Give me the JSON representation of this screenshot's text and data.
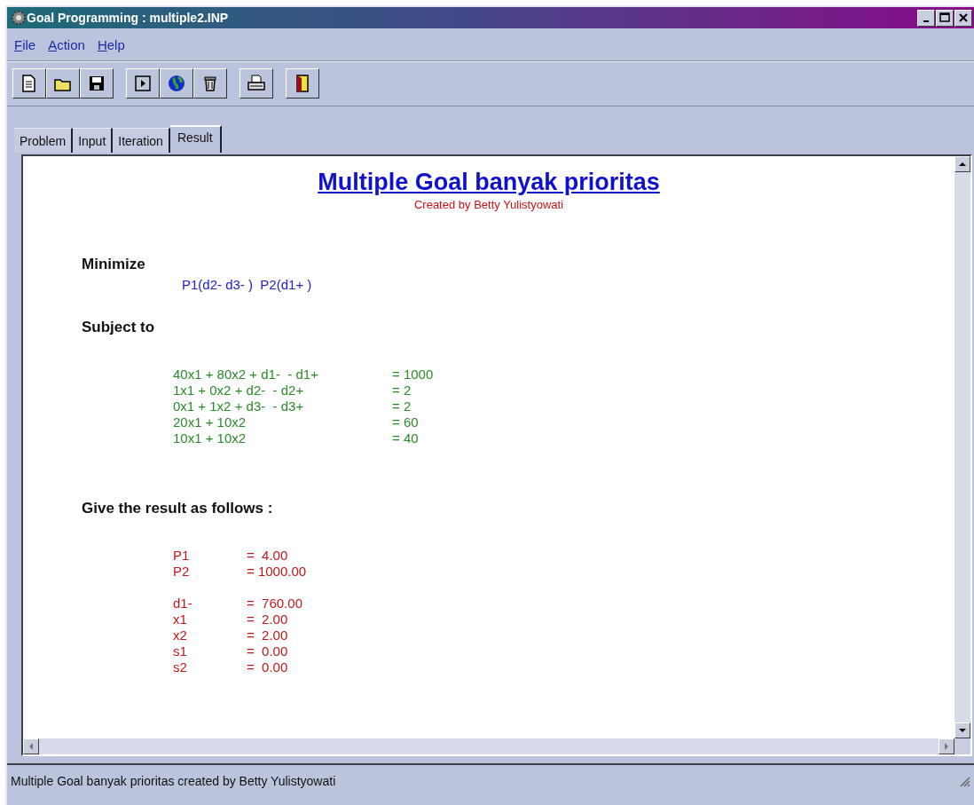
{
  "window": {
    "title": "Goal Programming : multiple2.INP"
  },
  "menu": [
    {
      "label": "File"
    },
    {
      "label": "Action"
    },
    {
      "label": "Help"
    }
  ],
  "tabs": [
    {
      "label": "Problem",
      "selected": false
    },
    {
      "label": "Input",
      "selected": false
    },
    {
      "label": "Iteration",
      "selected": false
    },
    {
      "label": "Result",
      "selected": true
    }
  ],
  "result": {
    "title": "Multiple Goal banyak prioritas",
    "subtitle": "Created by Betty Yulistyowati",
    "objective_heading": "Minimize",
    "objective": "P1(d2- d3- )  P2(d1+ )",
    "constraints_heading": "Subject to",
    "constraints": [
      {
        "lhs": "40x1 + 80x2 + d1-  - d1+",
        "rhs": "= 1000"
      },
      {
        "lhs": "1x1 + 0x2 + d2-  - d2+",
        "rhs": "= 2"
      },
      {
        "lhs": "0x1 + 1x2 + d3-  - d3+",
        "rhs": "= 2"
      },
      {
        "lhs": "20x1 + 10x2",
        "rhs": "= 60"
      },
      {
        "lhs": "10x1 + 10x2",
        "rhs": "= 40"
      }
    ],
    "results_heading": "Give the result as follows :",
    "result_groups": [
      [
        {
          "name": "P1",
          "value": "=  4.00"
        },
        {
          "name": "P2",
          "value": "= 1000.00"
        }
      ],
      [
        {
          "name": "d1-",
          "value": "=  760.00"
        },
        {
          "name": "x1",
          "value": "=  2.00"
        },
        {
          "name": "x2",
          "value": "=  2.00"
        },
        {
          "name": "s1",
          "value": "=  0.00"
        },
        {
          "name": "s2",
          "value": "=  0.00"
        }
      ]
    ]
  },
  "status_bar": "Multiple Goal banyak prioritas created by Betty Yulistyowati"
}
